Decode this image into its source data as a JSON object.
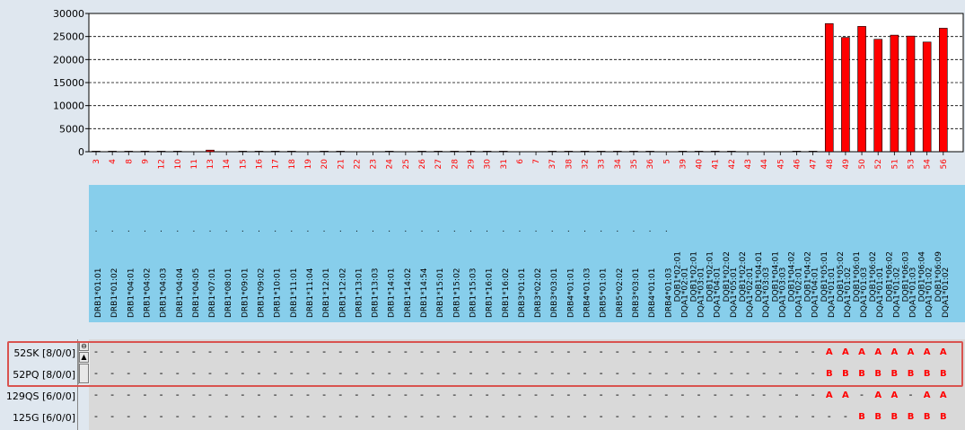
{
  "chart_data": {
    "type": "bar",
    "ylim": [
      0,
      30000
    ],
    "yticks": [
      0,
      5000,
      10000,
      15000,
      20000,
      25000,
      30000
    ],
    "grid": "dashed-horizontal",
    "bar_color": "#ff0000",
    "categories": [
      "3",
      "4",
      "8",
      "9",
      "12",
      "10",
      "11",
      "13",
      "14",
      "15",
      "16",
      "17",
      "18",
      "19",
      "20",
      "21",
      "22",
      "23",
      "24",
      "25",
      "26",
      "27",
      "28",
      "29",
      "30",
      "31",
      "6",
      "7",
      "37",
      "38",
      "32",
      "33",
      "34",
      "35",
      "36",
      "5",
      "39",
      "40",
      "41",
      "42",
      "43",
      "44",
      "45",
      "46",
      "47",
      "48",
      "49",
      "50",
      "52",
      "51",
      "53",
      "54",
      "56"
    ],
    "values": [
      120,
      120,
      120,
      120,
      120,
      120,
      0,
      350,
      0,
      120,
      120,
      120,
      120,
      0,
      120,
      120,
      0,
      0,
      120,
      0,
      120,
      120,
      120,
      120,
      120,
      120,
      0,
      0,
      120,
      120,
      120,
      120,
      120,
      120,
      120,
      0,
      120,
      120,
      120,
      120,
      0,
      0,
      0,
      120,
      120,
      27800,
      24800,
      27200,
      24400,
      25300,
      25100,
      23800,
      26800
    ],
    "header_top": [
      "",
      "",
      "",
      "",
      "",
      "",
      "",
      "",
      "",
      "",
      "",
      "",
      "",
      "",
      "",
      "",
      "",
      "",
      "",
      "",
      "",
      "",
      "",
      "",
      "",
      "",
      "",
      "",
      "",
      "",
      "",
      "",
      "",
      "",
      "",
      "",
      "DQB1*02:01",
      "DQB1*02:01",
      "DQB1*02:01",
      "DQB1*02:02",
      "DQB1*02:02",
      "DQB1*04:01",
      "DQB1*04:01",
      "DQB1*04:02",
      "DQB1*04:02",
      "DQB1*05:01",
      "DQB1*05:02",
      "DQB1*06:01",
      "DQB1*06:02",
      "DQB1*06:02",
      "DQB1*06:03",
      "DQB1*06:04",
      "DQB1*06:09"
    ],
    "header_bottom": [
      "DRB1*01:01",
      "DRB1*01:02",
      "DRB1*04:01",
      "DRB1*04:02",
      "DRB1*04:03",
      "DRB1*04:04",
      "DRB1*04:05",
      "DRB1*07:01",
      "DRB1*08:01",
      "DRB1*09:01",
      "DRB1*09:02",
      "DRB1*10:01",
      "DRB1*11:01",
      "DRB1*11:04",
      "DRB1*12:01",
      "DRB1*12:02",
      "DRB1*13:01",
      "DRB1*13:03",
      "DRB1*14:01",
      "DRB1*14:02",
      "DRB1*14:54",
      "DRB1*15:01",
      "DRB1*15:02",
      "DRB1*15:03",
      "DRB1*16:01",
      "DRB1*16:02",
      "DRB3*01:01",
      "DRB3*02:02",
      "DRB3*03:01",
      "DRB4*01:01",
      "DRB4*01:03",
      "DRB5*01:01",
      "DRB5*02:02",
      "DRB3*03:01",
      "DRB4*01:01",
      "DRB4*01:03",
      "DQA1*02:01",
      "DQA1*03:01",
      "DQA1*04:01",
      "DQA1*05:01",
      "DQA1*02:01",
      "DQA1*03:03",
      "DQA1*03:03",
      "DQA1*02:01",
      "DQA1*04:01",
      "DQA1*01:01",
      "DQA1*01:02",
      "DQA1*01:03",
      "DQA1*01:01",
      "DQA1*01:02",
      "DQA1*01:03",
      "DQA1*01:02",
      "DQA1*01:02"
    ]
  },
  "rows": [
    {
      "label": "52SK [8/0/0]",
      "cells": [
        "-",
        "-",
        "-",
        "-",
        "-",
        "-",
        "-",
        "-",
        "-",
        "-",
        "-",
        "-",
        "-",
        "-",
        "-",
        "-",
        "-",
        "-",
        "-",
        "-",
        "-",
        "-",
        "-",
        "-",
        "-",
        "-",
        "-",
        "-",
        "-",
        "-",
        "-",
        "-",
        "-",
        "-",
        "-",
        "-",
        "-",
        "-",
        "-",
        "-",
        "-",
        "-",
        "-",
        "-",
        "-",
        "A",
        "A",
        "A",
        "A",
        "A",
        "A",
        "A",
        "A"
      ]
    },
    {
      "label": "52PQ [8/0/0]",
      "cells": [
        "-",
        "-",
        "-",
        "-",
        "-",
        "-",
        "-",
        "-",
        "-",
        "-",
        "-",
        "-",
        "-",
        "-",
        "-",
        "-",
        "-",
        "-",
        "-",
        "-",
        "-",
        "-",
        "-",
        "-",
        "-",
        "-",
        "-",
        "-",
        "-",
        "-",
        "-",
        "-",
        "-",
        "-",
        "-",
        "-",
        "-",
        "-",
        "-",
        "-",
        "-",
        "-",
        "-",
        "-",
        "-",
        "B",
        "B",
        "B",
        "B",
        "B",
        "B",
        "B",
        "B"
      ]
    },
    {
      "label": "129QS [6/0/0]",
      "cells": [
        "-",
        "-",
        "-",
        "-",
        "-",
        "-",
        "-",
        "-",
        "-",
        "-",
        "-",
        "-",
        "-",
        "-",
        "-",
        "-",
        "-",
        "-",
        "-",
        "-",
        "-",
        "-",
        "-",
        "-",
        "-",
        "-",
        "-",
        "-",
        "-",
        "-",
        "-",
        "-",
        "-",
        "-",
        "-",
        "-",
        "-",
        "-",
        "-",
        "-",
        "-",
        "-",
        "-",
        "-",
        "-",
        "A",
        "A",
        "-",
        "A",
        "A",
        "-",
        "A",
        "A"
      ]
    },
    {
      "label": "125G [6/0/0]",
      "cells": [
        "-",
        "-",
        "-",
        "-",
        "-",
        "-",
        "-",
        "-",
        "-",
        "-",
        "-",
        "-",
        "-",
        "-",
        "-",
        "-",
        "-",
        "-",
        "-",
        "-",
        "-",
        "-",
        "-",
        "-",
        "-",
        "-",
        "-",
        "-",
        "-",
        "-",
        "-",
        "-",
        "-",
        "-",
        "-",
        "-",
        "-",
        "-",
        "-",
        "-",
        "-",
        "-",
        "-",
        "-",
        "-",
        "-",
        "-",
        "B",
        "B",
        "B",
        "B",
        "B",
        "B"
      ]
    }
  ],
  "scroll": {
    "collapse_label": "⊖",
    "up_label": "▲",
    "down_label": ""
  },
  "colors": {
    "highlight": "#d9534f",
    "header_band": "#87ceeb",
    "cell_text": "#ff0000"
  }
}
